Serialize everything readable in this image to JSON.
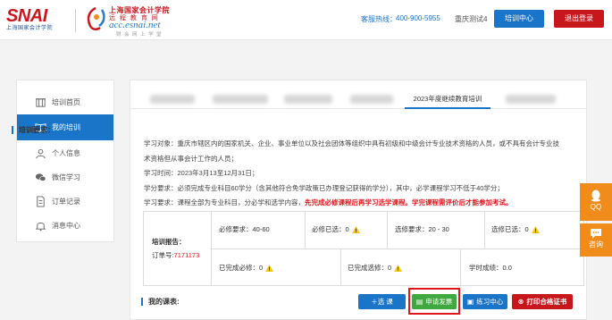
{
  "header": {
    "logo_snai_text": "SNAI",
    "logo_snai_sub": "上海国家会计学院",
    "logo_acc_line1": "上海国家会计学院",
    "logo_acc_line2": "远 程 教 育 网",
    "logo_acc_line3": "acc.esnai.net",
    "logo_acc_line4": "财 会 网 上 学 堂",
    "hotline_label": "客服热线：",
    "hotline_value": "400-900-5955",
    "user_name": "重庆测试4",
    "center_button": "培训中心",
    "logout_button": "退出登录",
    "brand_blue": "#1a74c8",
    "brand_red": "#c8161d"
  },
  "sidebar": {
    "items": [
      {
        "label": "培训首页",
        "icon": "home-icon",
        "active": false
      },
      {
        "label": "我的培训",
        "icon": "book-icon",
        "active": true
      },
      {
        "label": "个人信息",
        "icon": "person-icon",
        "active": false
      },
      {
        "label": "微信学习",
        "icon": "wechat-icon",
        "active": false
      },
      {
        "label": "订单记录",
        "icon": "document-icon",
        "active": false
      },
      {
        "label": "消息中心",
        "icon": "bell-icon",
        "active": false
      }
    ]
  },
  "tabs": {
    "active_label": "2023年度继续教育培训"
  },
  "requirements": {
    "title": "培训要求：",
    "object_line1": "学习对象：重庆市辖区内的国家机关、企业、事业单位以及社会团体等组织中具有初级和中级会计专业技术资格的人员，或不具有会计专业技",
    "object_line2": "术资格但从事会计工作的人员；",
    "time_line": "学习时间：2023年3月13至12月31日；",
    "credit_line": "学分要求：必须完成专业科目60学分（含其他符合免学政策已办理登记获得的学分），其中，必学课程学习不低于40学分；",
    "study_line_prefix": "学习要求：课程全部为专业科目，分必学和选学内容，",
    "study_line_red": "先完成必修课程后再学习选学课程。学完课程需评价后才能参加考试。"
  },
  "report": {
    "label": "培训报告：",
    "order_label": "订单号:",
    "order_number": "7171173",
    "required_req": "必修要求：40-60",
    "required_selected": "必修已选：0",
    "elective_req": "选修要求：20 - 30",
    "elective_selected": "选修已选：0",
    "required_done": "已完成必修：0",
    "elective_done": "已完成选修：0",
    "score": "学时成绩：0.0"
  },
  "courses": {
    "title": "我的课表:",
    "select_button": "＋选 课",
    "invoice_button": "申请发票",
    "practice_button": "练习中心",
    "certificate_button": "打印合格证书"
  },
  "floating": {
    "qq_label": "QQ",
    "consult_label": "咨询",
    "accent": "#f08c1c"
  }
}
